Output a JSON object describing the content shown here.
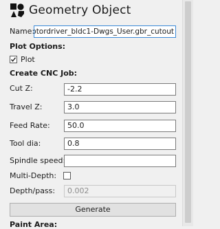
{
  "header": {
    "title": "Geometry Object",
    "icon": "geometry-icon"
  },
  "name_field": {
    "label": "Name:",
    "value": "otordriver_bldc1-Dwgs_User.gbr_cutout"
  },
  "plot_options": {
    "heading": "Plot Options:",
    "plot_checkbox": {
      "label": "Plot",
      "checked": true
    }
  },
  "cnc_job": {
    "heading": "Create CNC Job:",
    "cut_z": {
      "label": "Cut Z:",
      "value": "-2.2"
    },
    "travel_z": {
      "label": "Travel Z:",
      "value": "3.0"
    },
    "feed_rate": {
      "label": "Feed Rate:",
      "value": "50.0"
    },
    "tool_dia": {
      "label": "Tool dia:",
      "value": "0.8"
    },
    "spindle_speed": {
      "label": "Spindle speed:",
      "value": ""
    },
    "multi_depth": {
      "label": "Multi-Depth:",
      "checked": false
    },
    "depth_pass": {
      "label": "Depth/pass:",
      "value": "0.002"
    },
    "generate_label": "Generate"
  },
  "paint_area": {
    "heading": "Paint Area:"
  },
  "colors": {
    "focus_border": "#3c8ad8",
    "panel_bg": "#f0f0f0",
    "button_bg": "#e1e1e1"
  }
}
